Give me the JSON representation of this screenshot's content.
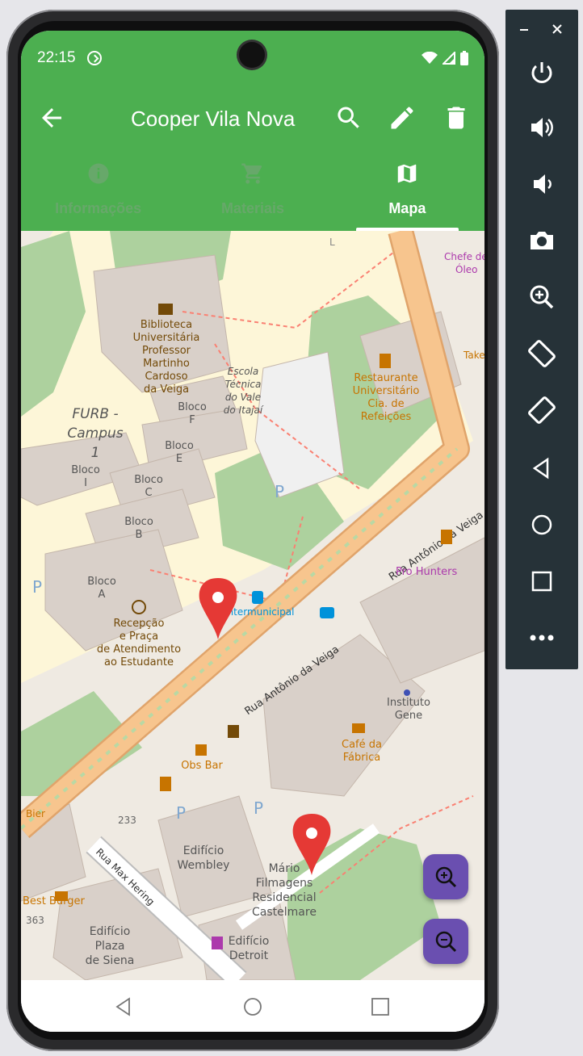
{
  "status_bar": {
    "time": "22:15"
  },
  "app_bar": {
    "title": "Cooper Vila Nova"
  },
  "tabs": [
    {
      "label": "Informações",
      "icon": "info-icon",
      "active": false
    },
    {
      "label": "Materiais",
      "icon": "cart-icon",
      "active": false
    },
    {
      "label": "Mapa",
      "icon": "map-icon",
      "active": true
    }
  ],
  "map": {
    "labels": {
      "biblioteca": [
        "Biblioteca",
        "Universitária",
        "Professor",
        "Martinho",
        "Cardoso",
        "da Veiga"
      ],
      "escola": [
        "Escola",
        "Técnica",
        "do Vale",
        "do Itajaí"
      ],
      "restaurante": [
        "Restaurante",
        "Universitário",
        "Cia. de",
        "Refeições"
      ],
      "furb": [
        "FURB -",
        "Campus",
        "1"
      ],
      "bloco_f": [
        "Bloco",
        "F"
      ],
      "bloco_e": [
        "Bloco",
        "E"
      ],
      "bloco_i": [
        "Bloco",
        "I"
      ],
      "bloco_c": [
        "Bloco",
        "C"
      ],
      "bloco_b": [
        "Bloco",
        "B"
      ],
      "bloco_a": [
        "Bloco",
        "A"
      ],
      "recepcao": [
        "Recepção",
        "e Praça",
        "de Atendimento",
        "ao Estudante"
      ],
      "street_main_1": "Rua Antônio da Veiga",
      "street_main_2": "Rua Antônio da Veiga",
      "street_max": "Rua Max Hering",
      "intermunicipal": "Intermunicipal",
      "pro_hunters": "Pro Hunters",
      "chefe": [
        "Chefe de",
        "Óleo"
      ],
      "take": "Take",
      "instituto": [
        "Instituto",
        "Gene"
      ],
      "cafe": [
        "Café da",
        "Fábrica"
      ],
      "obs_bar": "Obs Bar",
      "edificio_wembley": [
        "Edifício",
        "Wembley"
      ],
      "mario": [
        "Mário",
        "Filmagens",
        "Residencial",
        "Castelmare"
      ],
      "best_burger": "Best Burger",
      "edificio_plaza": [
        "Edifício",
        "Plaza",
        "de Siena"
      ],
      "edificio_detroit": [
        "Edifício",
        "Detroit"
      ],
      "num_233": "233",
      "num_363": "363",
      "bier": "Bier",
      "letter_l": "L",
      "parking": "P"
    }
  },
  "colors": {
    "app_bar": "#4caf50",
    "tab_inactive": "#67a86a",
    "fab": "#6a4fb0",
    "marker": "#e53935",
    "road_main": "#f7c58e",
    "green_area": "#add19e",
    "emulator_panel": "#263238"
  },
  "emulator_panel": {
    "buttons": [
      "power-icon",
      "volume-up-icon",
      "volume-down-icon",
      "camera-icon",
      "zoom-icon",
      "rotate-left-icon",
      "rotate-right-icon",
      "back-icon",
      "home-icon",
      "overview-icon",
      "more-icon"
    ]
  }
}
